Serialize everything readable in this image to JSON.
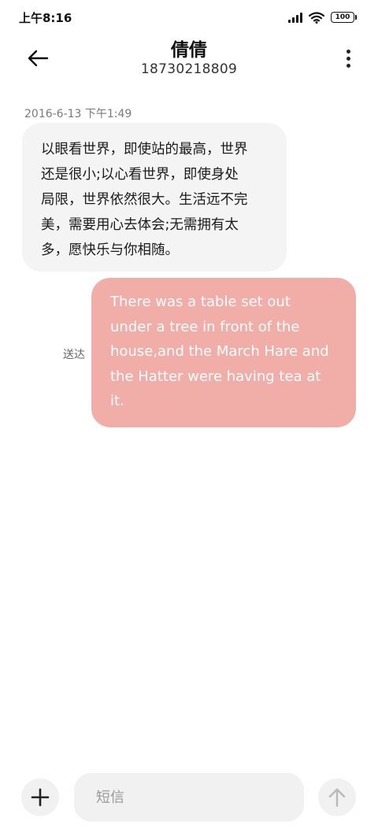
{
  "status_bar": {
    "time": "上午8:16",
    "battery": "100",
    "icons": [
      "signal-icon",
      "wifi-icon",
      "battery-icon"
    ]
  },
  "header": {
    "contact_name": "倩倩",
    "contact_number": "18730218809",
    "icons": [
      "back-arrow-icon",
      "more-vertical-icon"
    ]
  },
  "messages": {
    "timestamp": "2016-6-13 下午1:49",
    "received": {
      "lines": [
        "以眼看世界，即使站的最高，世界",
        "还是很小;以心看世界，即使身处",
        "局限，世界依然很大。生活远不完",
        "美，需要用心去体会;无需拥有太",
        "多，愿快乐与你相随。"
      ]
    },
    "sent": {
      "status": "送达",
      "lines": [
        "There was a table set out",
        "under a tree in front of the",
        "house,and the March Hare and",
        "the Hatter were having tea at",
        "it."
      ]
    }
  },
  "composer": {
    "placeholder": "短信",
    "icons": [
      "plus-icon",
      "send-arrow-icon"
    ]
  },
  "colors": {
    "sent_bubble": "#f1aea8",
    "received_bubble": "#f4f4f4",
    "composer_bg": "#f1f1f1"
  }
}
